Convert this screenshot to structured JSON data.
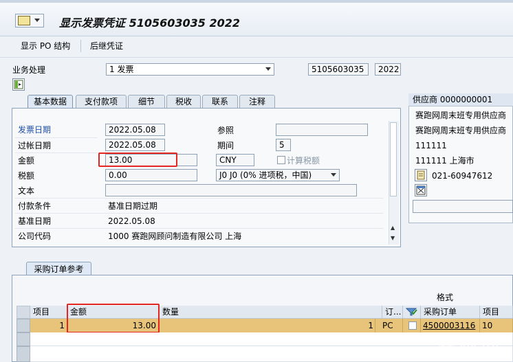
{
  "window": {
    "title": "显示发票凭证 5105603035 2022"
  },
  "toolbar": {
    "display_po_structure": "显示 PO 结构",
    "subsequent_doc": "后继凭证"
  },
  "header": {
    "transaction_label": "业务处理",
    "transaction_value": "1 发票",
    "doc_number": "5105603035",
    "fiscal_year": "2022"
  },
  "tabs": [
    {
      "label": "基本数据",
      "active": true
    },
    {
      "label": "支付款项"
    },
    {
      "label": "细节"
    },
    {
      "label": "税收"
    },
    {
      "label": "联系"
    },
    {
      "label": "注释"
    }
  ],
  "basic": {
    "invoice_date_label": "发票日期",
    "invoice_date": "2022.05.08",
    "reference_label": "参照",
    "reference": "",
    "posting_date_label": "过帐日期",
    "posting_date": "2022.05.08",
    "period_label": "期间",
    "period": "5",
    "amount_label": "金额",
    "amount": "13.00",
    "currency": "CNY",
    "calc_tax_label": "计算税额",
    "tax_amount_label": "税额",
    "tax_amount": "0.00",
    "tax_code": "J0 J0 (0% 进项税，中国)",
    "text_label": "文本",
    "text": "",
    "payment_terms_label": "付款条件",
    "payment_terms": "基准日期过期",
    "baseline_date_label": "基准日期",
    "baseline_date": "2022.05.08",
    "company_code_label": "公司代码",
    "company_code": "1000 赛跑网顾问制造有限公司 上海"
  },
  "vendor": {
    "header": "供应商 0000000001",
    "line1": "赛跑网周末班专用供应商",
    "line2": "赛跑网周末班专用供应商",
    "line3": "111111",
    "line4": "111111 上海市",
    "phone": "021-60947612"
  },
  "po_ref": {
    "tab_label": "采购订单参考",
    "layout_label": "格式",
    "columns": {
      "item": "项目",
      "amount": "金额",
      "quantity": "数量",
      "order_unit": "订...",
      "po": "采购订单",
      "po_item": "项目"
    },
    "rows": [
      {
        "item": "1",
        "amount": "13.00",
        "quantity": "1",
        "unit": "PC",
        "po": "4500003116",
        "po_item": "10"
      }
    ]
  },
  "colors": {
    "highlight_row": "#e7c47a",
    "annotation_red": "#e3261f"
  },
  "watermark": "赛跑网"
}
